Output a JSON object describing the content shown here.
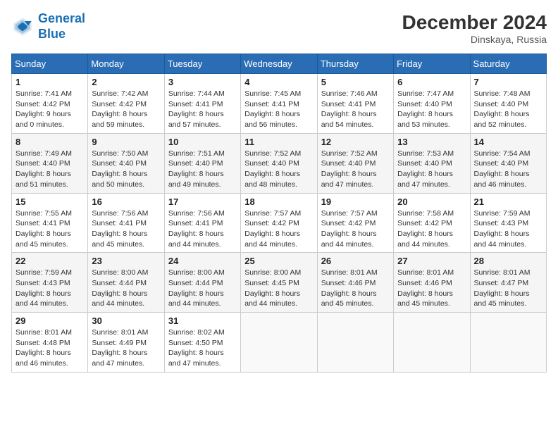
{
  "header": {
    "logo_line1": "General",
    "logo_line2": "Blue",
    "month": "December 2024",
    "location": "Dinskaya, Russia"
  },
  "weekdays": [
    "Sunday",
    "Monday",
    "Tuesday",
    "Wednesday",
    "Thursday",
    "Friday",
    "Saturday"
  ],
  "weeks": [
    [
      {
        "day": "1",
        "sunrise": "Sunrise: 7:41 AM",
        "sunset": "Sunset: 4:42 PM",
        "daylight": "Daylight: 9 hours and 0 minutes."
      },
      {
        "day": "2",
        "sunrise": "Sunrise: 7:42 AM",
        "sunset": "Sunset: 4:42 PM",
        "daylight": "Daylight: 8 hours and 59 minutes."
      },
      {
        "day": "3",
        "sunrise": "Sunrise: 7:44 AM",
        "sunset": "Sunset: 4:41 PM",
        "daylight": "Daylight: 8 hours and 57 minutes."
      },
      {
        "day": "4",
        "sunrise": "Sunrise: 7:45 AM",
        "sunset": "Sunset: 4:41 PM",
        "daylight": "Daylight: 8 hours and 56 minutes."
      },
      {
        "day": "5",
        "sunrise": "Sunrise: 7:46 AM",
        "sunset": "Sunset: 4:41 PM",
        "daylight": "Daylight: 8 hours and 54 minutes."
      },
      {
        "day": "6",
        "sunrise": "Sunrise: 7:47 AM",
        "sunset": "Sunset: 4:40 PM",
        "daylight": "Daylight: 8 hours and 53 minutes."
      },
      {
        "day": "7",
        "sunrise": "Sunrise: 7:48 AM",
        "sunset": "Sunset: 4:40 PM",
        "daylight": "Daylight: 8 hours and 52 minutes."
      }
    ],
    [
      {
        "day": "8",
        "sunrise": "Sunrise: 7:49 AM",
        "sunset": "Sunset: 4:40 PM",
        "daylight": "Daylight: 8 hours and 51 minutes."
      },
      {
        "day": "9",
        "sunrise": "Sunrise: 7:50 AM",
        "sunset": "Sunset: 4:40 PM",
        "daylight": "Daylight: 8 hours and 50 minutes."
      },
      {
        "day": "10",
        "sunrise": "Sunrise: 7:51 AM",
        "sunset": "Sunset: 4:40 PM",
        "daylight": "Daylight: 8 hours and 49 minutes."
      },
      {
        "day": "11",
        "sunrise": "Sunrise: 7:52 AM",
        "sunset": "Sunset: 4:40 PM",
        "daylight": "Daylight: 8 hours and 48 minutes."
      },
      {
        "day": "12",
        "sunrise": "Sunrise: 7:52 AM",
        "sunset": "Sunset: 4:40 PM",
        "daylight": "Daylight: 8 hours and 47 minutes."
      },
      {
        "day": "13",
        "sunrise": "Sunrise: 7:53 AM",
        "sunset": "Sunset: 4:40 PM",
        "daylight": "Daylight: 8 hours and 47 minutes."
      },
      {
        "day": "14",
        "sunrise": "Sunrise: 7:54 AM",
        "sunset": "Sunset: 4:40 PM",
        "daylight": "Daylight: 8 hours and 46 minutes."
      }
    ],
    [
      {
        "day": "15",
        "sunrise": "Sunrise: 7:55 AM",
        "sunset": "Sunset: 4:41 PM",
        "daylight": "Daylight: 8 hours and 45 minutes."
      },
      {
        "day": "16",
        "sunrise": "Sunrise: 7:56 AM",
        "sunset": "Sunset: 4:41 PM",
        "daylight": "Daylight: 8 hours and 45 minutes."
      },
      {
        "day": "17",
        "sunrise": "Sunrise: 7:56 AM",
        "sunset": "Sunset: 4:41 PM",
        "daylight": "Daylight: 8 hours and 44 minutes."
      },
      {
        "day": "18",
        "sunrise": "Sunrise: 7:57 AM",
        "sunset": "Sunset: 4:42 PM",
        "daylight": "Daylight: 8 hours and 44 minutes."
      },
      {
        "day": "19",
        "sunrise": "Sunrise: 7:57 AM",
        "sunset": "Sunset: 4:42 PM",
        "daylight": "Daylight: 8 hours and 44 minutes."
      },
      {
        "day": "20",
        "sunrise": "Sunrise: 7:58 AM",
        "sunset": "Sunset: 4:42 PM",
        "daylight": "Daylight: 8 hours and 44 minutes."
      },
      {
        "day": "21",
        "sunrise": "Sunrise: 7:59 AM",
        "sunset": "Sunset: 4:43 PM",
        "daylight": "Daylight: 8 hours and 44 minutes."
      }
    ],
    [
      {
        "day": "22",
        "sunrise": "Sunrise: 7:59 AM",
        "sunset": "Sunset: 4:43 PM",
        "daylight": "Daylight: 8 hours and 44 minutes."
      },
      {
        "day": "23",
        "sunrise": "Sunrise: 8:00 AM",
        "sunset": "Sunset: 4:44 PM",
        "daylight": "Daylight: 8 hours and 44 minutes."
      },
      {
        "day": "24",
        "sunrise": "Sunrise: 8:00 AM",
        "sunset": "Sunset: 4:44 PM",
        "daylight": "Daylight: 8 hours and 44 minutes."
      },
      {
        "day": "25",
        "sunrise": "Sunrise: 8:00 AM",
        "sunset": "Sunset: 4:45 PM",
        "daylight": "Daylight: 8 hours and 44 minutes."
      },
      {
        "day": "26",
        "sunrise": "Sunrise: 8:01 AM",
        "sunset": "Sunset: 4:46 PM",
        "daylight": "Daylight: 8 hours and 45 minutes."
      },
      {
        "day": "27",
        "sunrise": "Sunrise: 8:01 AM",
        "sunset": "Sunset: 4:46 PM",
        "daylight": "Daylight: 8 hours and 45 minutes."
      },
      {
        "day": "28",
        "sunrise": "Sunrise: 8:01 AM",
        "sunset": "Sunset: 4:47 PM",
        "daylight": "Daylight: 8 hours and 45 minutes."
      }
    ],
    [
      {
        "day": "29",
        "sunrise": "Sunrise: 8:01 AM",
        "sunset": "Sunset: 4:48 PM",
        "daylight": "Daylight: 8 hours and 46 minutes."
      },
      {
        "day": "30",
        "sunrise": "Sunrise: 8:01 AM",
        "sunset": "Sunset: 4:49 PM",
        "daylight": "Daylight: 8 hours and 47 minutes."
      },
      {
        "day": "31",
        "sunrise": "Sunrise: 8:02 AM",
        "sunset": "Sunset: 4:50 PM",
        "daylight": "Daylight: 8 hours and 47 minutes."
      },
      null,
      null,
      null,
      null
    ]
  ]
}
